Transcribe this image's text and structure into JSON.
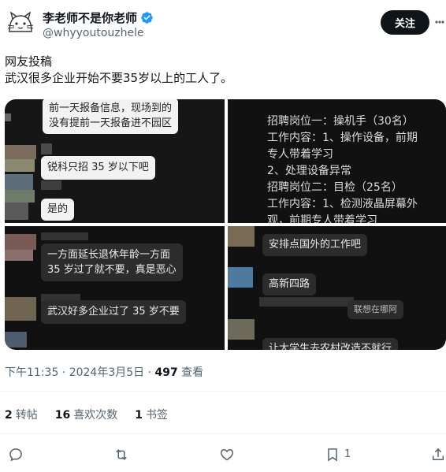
{
  "author": {
    "display_name": "李老师不是你老师",
    "handle": "@whyyoutouzhele",
    "follow_label": "关注"
  },
  "tweet": {
    "line1": "网友投稿",
    "line2": "武汉很多企业开始不要35岁以上的工人了。"
  },
  "media": {
    "panel1": {
      "bubble1_line1": "前一天报备信息，现场到的",
      "bubble1_line2": "没有提前一天报备进不园区",
      "bubble2": "锐科只招 35 岁以下吧",
      "bubble3": "是的"
    },
    "panel2": {
      "recruit_text": "招聘岗位一：操机手（30名）\n工作内容：1、操作设备，前期\n专人带着学习\n2、处理设备异常\n招聘岗位二：目检（25名）\n工作内容：1、检测液晶屏幕外\n观，前期专人带着学习"
    },
    "panel3": {
      "bubble1_line1": "一方面延长退休年龄一方面",
      "bubble1_line2": "35 岁过了就不要，真是恶心",
      "bubble2": "武汉好多企业过了 35 岁不要"
    },
    "panel4": {
      "bubble1": "安排点国外的工作吧",
      "bubble2": "高新四路",
      "bubble3": "联想在哪阿",
      "bubble4": "让大学生去农村改造不就行"
    }
  },
  "meta": {
    "time": "下午11:35 · 2024年3月5日 · ",
    "views": "497",
    "views_label": " 查看"
  },
  "stats": {
    "retweets": "2",
    "retweets_label": "转帖",
    "quotes": "16",
    "quotes_label": "喜欢次数",
    "bookmarks": "1",
    "bookmarks_label": "书签"
  },
  "actions": {
    "bookmark_count": "1"
  },
  "colors": {
    "text": "#0f1419",
    "secondary": "#536471",
    "verified": "#1d9bf0"
  }
}
